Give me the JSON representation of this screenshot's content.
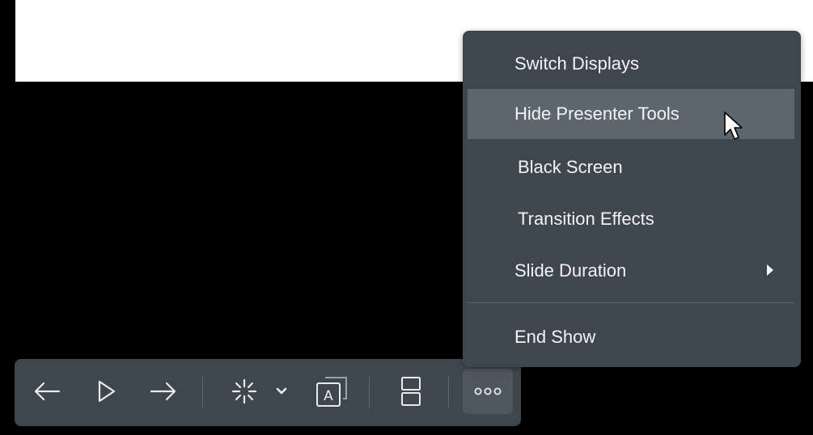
{
  "menu": {
    "items": [
      {
        "label": "Switch Displays"
      },
      {
        "label": "Hide Presenter Tools"
      },
      {
        "label": "Black Screen"
      },
      {
        "label": "Transition Effects"
      },
      {
        "label": "Slide Duration"
      },
      {
        "label": "End Show"
      }
    ]
  },
  "toolbar": {
    "buttons": [
      {
        "icon": "arrow-left-icon"
      },
      {
        "icon": "play-icon"
      },
      {
        "icon": "arrow-right-icon"
      },
      {
        "icon": "laser-pointer-icon"
      },
      {
        "icon": "chevron-down-icon"
      },
      {
        "icon": "text-annotation-icon"
      },
      {
        "icon": "layout-icon"
      },
      {
        "icon": "more-icon"
      }
    ]
  },
  "colors": {
    "panel": "#3f474e",
    "hover": "#5d666d",
    "text": "#f1f3f5"
  }
}
